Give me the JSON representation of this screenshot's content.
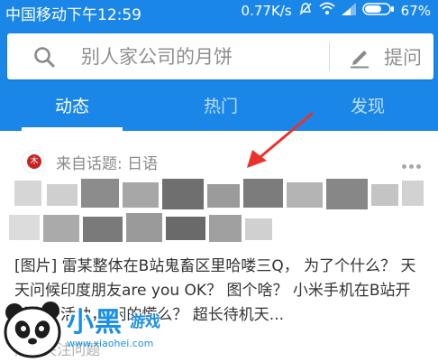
{
  "status_bar": {
    "network": "中国移动",
    "time": "下午12:59",
    "speed": "0.77K/s",
    "battery": "67%"
  },
  "search": {
    "placeholder": "别人家公司的月饼",
    "ask_label": "提问"
  },
  "tabs": [
    {
      "label": "动态",
      "active": true
    },
    {
      "label": "热门",
      "active": false
    },
    {
      "label": "发现",
      "active": false
    }
  ],
  "feed": {
    "card": {
      "topic_source": "来自话题: 日语",
      "avatar_mark": "木",
      "excerpt": "[图片] 雷某整体在B站鬼畜区里哈喽三Q， 为了个什么？ 天天问候印度朋友are you OK？ 图个啥？ 小米手机在B站开过多少活动， 闲的慌么？ 超长待机天...",
      "footer_faded": "同 · 关注问题"
    }
  },
  "watermark": {
    "title": "小黑",
    "subtitle": "游戏",
    "url": "www.xiaohei.com"
  },
  "colors": {
    "brand_blue": "#1a87e8",
    "annotation_red": "#e8322b"
  }
}
